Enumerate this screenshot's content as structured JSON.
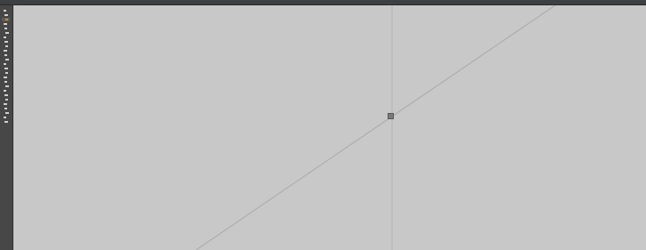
{
  "app": {
    "tools": [
      {
        "icon": "selection-icon"
      },
      {
        "icon": "direct-selection-icon"
      },
      {
        "icon": "active-tool-icon",
        "active": true
      },
      {
        "icon": "pen-icon"
      },
      {
        "icon": "type-icon"
      },
      {
        "icon": "line-segment-icon"
      },
      {
        "icon": "rectangle-icon"
      },
      {
        "icon": "paintbrush-icon"
      },
      {
        "icon": "pencil-icon"
      },
      {
        "icon": "eraser-icon"
      },
      {
        "icon": "rotate-icon"
      },
      {
        "icon": "scale-icon"
      },
      {
        "icon": "warp-icon"
      },
      {
        "icon": "free-transform-icon"
      },
      {
        "icon": "shape-builder-icon"
      },
      {
        "icon": "perspective-icon"
      },
      {
        "icon": "mesh-icon"
      },
      {
        "icon": "gradient-icon"
      },
      {
        "icon": "eyedropper-icon"
      },
      {
        "icon": "blend-icon"
      },
      {
        "icon": "symbol-sprayer-icon"
      },
      {
        "icon": "graph-icon"
      },
      {
        "icon": "artboard-icon"
      },
      {
        "icon": "slice-icon"
      },
      {
        "icon": "hand-icon"
      },
      {
        "icon": "zoom-icon"
      }
    ],
    "colors": {
      "chrome": "#3e3f40",
      "toolbar": "#474747",
      "canvas": "#c8c8c8",
      "accent": "#c98a3a",
      "guide": "#b5b5b5",
      "path": "#a9a9a9"
    }
  }
}
